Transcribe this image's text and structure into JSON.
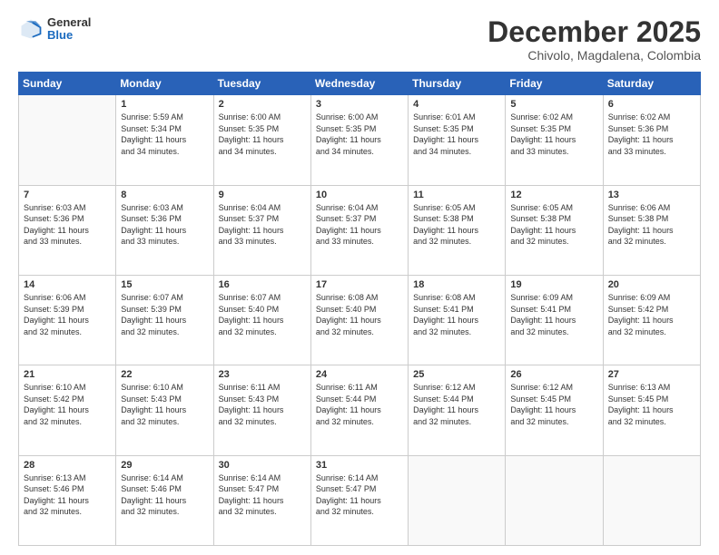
{
  "header": {
    "logo_general": "General",
    "logo_blue": "Blue",
    "main_title": "December 2025",
    "sub_title": "Chivolo, Magdalena, Colombia"
  },
  "days_of_week": [
    "Sunday",
    "Monday",
    "Tuesday",
    "Wednesday",
    "Thursday",
    "Friday",
    "Saturday"
  ],
  "weeks": [
    [
      {
        "day": "",
        "info": ""
      },
      {
        "day": "1",
        "info": "Sunrise: 5:59 AM\nSunset: 5:34 PM\nDaylight: 11 hours\nand 34 minutes."
      },
      {
        "day": "2",
        "info": "Sunrise: 6:00 AM\nSunset: 5:35 PM\nDaylight: 11 hours\nand 34 minutes."
      },
      {
        "day": "3",
        "info": "Sunrise: 6:00 AM\nSunset: 5:35 PM\nDaylight: 11 hours\nand 34 minutes."
      },
      {
        "day": "4",
        "info": "Sunrise: 6:01 AM\nSunset: 5:35 PM\nDaylight: 11 hours\nand 34 minutes."
      },
      {
        "day": "5",
        "info": "Sunrise: 6:02 AM\nSunset: 5:35 PM\nDaylight: 11 hours\nand 33 minutes."
      },
      {
        "day": "6",
        "info": "Sunrise: 6:02 AM\nSunset: 5:36 PM\nDaylight: 11 hours\nand 33 minutes."
      }
    ],
    [
      {
        "day": "7",
        "info": "Sunrise: 6:03 AM\nSunset: 5:36 PM\nDaylight: 11 hours\nand 33 minutes."
      },
      {
        "day": "8",
        "info": "Sunrise: 6:03 AM\nSunset: 5:36 PM\nDaylight: 11 hours\nand 33 minutes."
      },
      {
        "day": "9",
        "info": "Sunrise: 6:04 AM\nSunset: 5:37 PM\nDaylight: 11 hours\nand 33 minutes."
      },
      {
        "day": "10",
        "info": "Sunrise: 6:04 AM\nSunset: 5:37 PM\nDaylight: 11 hours\nand 33 minutes."
      },
      {
        "day": "11",
        "info": "Sunrise: 6:05 AM\nSunset: 5:38 PM\nDaylight: 11 hours\nand 32 minutes."
      },
      {
        "day": "12",
        "info": "Sunrise: 6:05 AM\nSunset: 5:38 PM\nDaylight: 11 hours\nand 32 minutes."
      },
      {
        "day": "13",
        "info": "Sunrise: 6:06 AM\nSunset: 5:38 PM\nDaylight: 11 hours\nand 32 minutes."
      }
    ],
    [
      {
        "day": "14",
        "info": "Sunrise: 6:06 AM\nSunset: 5:39 PM\nDaylight: 11 hours\nand 32 minutes."
      },
      {
        "day": "15",
        "info": "Sunrise: 6:07 AM\nSunset: 5:39 PM\nDaylight: 11 hours\nand 32 minutes."
      },
      {
        "day": "16",
        "info": "Sunrise: 6:07 AM\nSunset: 5:40 PM\nDaylight: 11 hours\nand 32 minutes."
      },
      {
        "day": "17",
        "info": "Sunrise: 6:08 AM\nSunset: 5:40 PM\nDaylight: 11 hours\nand 32 minutes."
      },
      {
        "day": "18",
        "info": "Sunrise: 6:08 AM\nSunset: 5:41 PM\nDaylight: 11 hours\nand 32 minutes."
      },
      {
        "day": "19",
        "info": "Sunrise: 6:09 AM\nSunset: 5:41 PM\nDaylight: 11 hours\nand 32 minutes."
      },
      {
        "day": "20",
        "info": "Sunrise: 6:09 AM\nSunset: 5:42 PM\nDaylight: 11 hours\nand 32 minutes."
      }
    ],
    [
      {
        "day": "21",
        "info": "Sunrise: 6:10 AM\nSunset: 5:42 PM\nDaylight: 11 hours\nand 32 minutes."
      },
      {
        "day": "22",
        "info": "Sunrise: 6:10 AM\nSunset: 5:43 PM\nDaylight: 11 hours\nand 32 minutes."
      },
      {
        "day": "23",
        "info": "Sunrise: 6:11 AM\nSunset: 5:43 PM\nDaylight: 11 hours\nand 32 minutes."
      },
      {
        "day": "24",
        "info": "Sunrise: 6:11 AM\nSunset: 5:44 PM\nDaylight: 11 hours\nand 32 minutes."
      },
      {
        "day": "25",
        "info": "Sunrise: 6:12 AM\nSunset: 5:44 PM\nDaylight: 11 hours\nand 32 minutes."
      },
      {
        "day": "26",
        "info": "Sunrise: 6:12 AM\nSunset: 5:45 PM\nDaylight: 11 hours\nand 32 minutes."
      },
      {
        "day": "27",
        "info": "Sunrise: 6:13 AM\nSunset: 5:45 PM\nDaylight: 11 hours\nand 32 minutes."
      }
    ],
    [
      {
        "day": "28",
        "info": "Sunrise: 6:13 AM\nSunset: 5:46 PM\nDaylight: 11 hours\nand 32 minutes."
      },
      {
        "day": "29",
        "info": "Sunrise: 6:14 AM\nSunset: 5:46 PM\nDaylight: 11 hours\nand 32 minutes."
      },
      {
        "day": "30",
        "info": "Sunrise: 6:14 AM\nSunset: 5:47 PM\nDaylight: 11 hours\nand 32 minutes."
      },
      {
        "day": "31",
        "info": "Sunrise: 6:14 AM\nSunset: 5:47 PM\nDaylight: 11 hours\nand 32 minutes."
      },
      {
        "day": "",
        "info": ""
      },
      {
        "day": "",
        "info": ""
      },
      {
        "day": "",
        "info": ""
      }
    ]
  ]
}
